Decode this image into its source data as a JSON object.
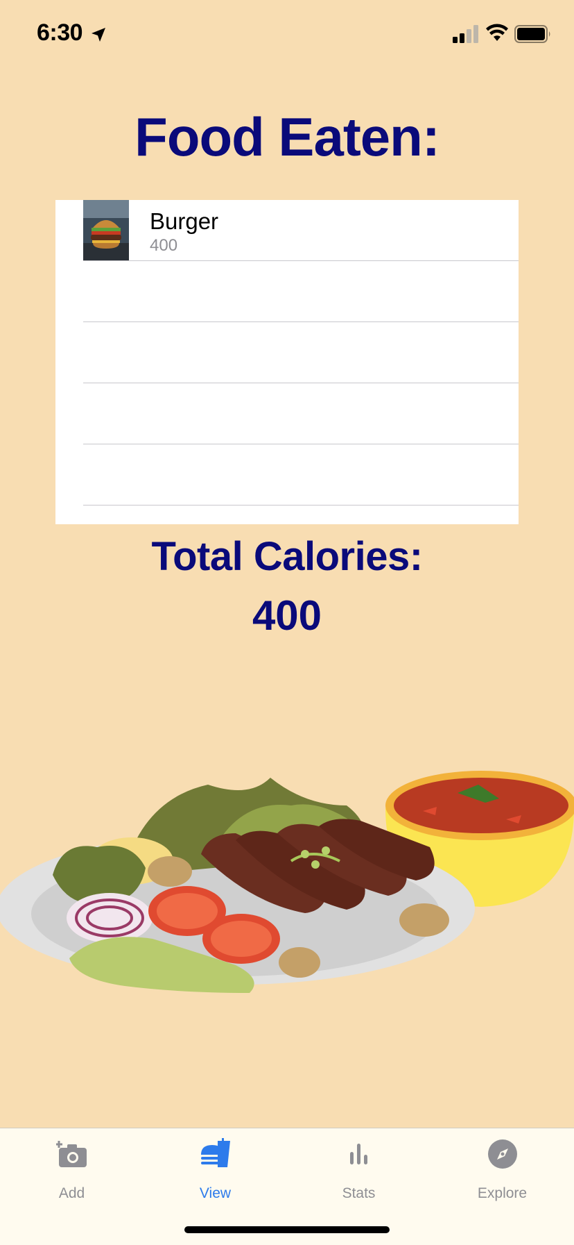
{
  "status": {
    "time": "6:30"
  },
  "header": {
    "title": "Food Eaten:"
  },
  "food_list": {
    "items": [
      {
        "name": "Burger",
        "calories": "400",
        "thumbnail": "burger-photo"
      }
    ],
    "empty_rows": 4
  },
  "totals": {
    "label": "Total Calories:",
    "value": "400"
  },
  "illustration": {
    "name": "plate-of-food-illustration"
  },
  "tab_bar": {
    "tabs": [
      {
        "label": "Add",
        "icon": "add-photo-camera-icon",
        "active": false
      },
      {
        "label": "View",
        "icon": "food-view-icon",
        "active": true
      },
      {
        "label": "Stats",
        "icon": "bar-chart-icon",
        "active": false
      },
      {
        "label": "Explore",
        "icon": "compass-icon",
        "active": false
      }
    ]
  },
  "colors": {
    "background": "#F8DDB2",
    "title": "#0A0A7A",
    "tab_active": "#2D7BEB",
    "tab_inactive": "#8E8E93",
    "tab_bar_bg": "#FFFBEF"
  }
}
